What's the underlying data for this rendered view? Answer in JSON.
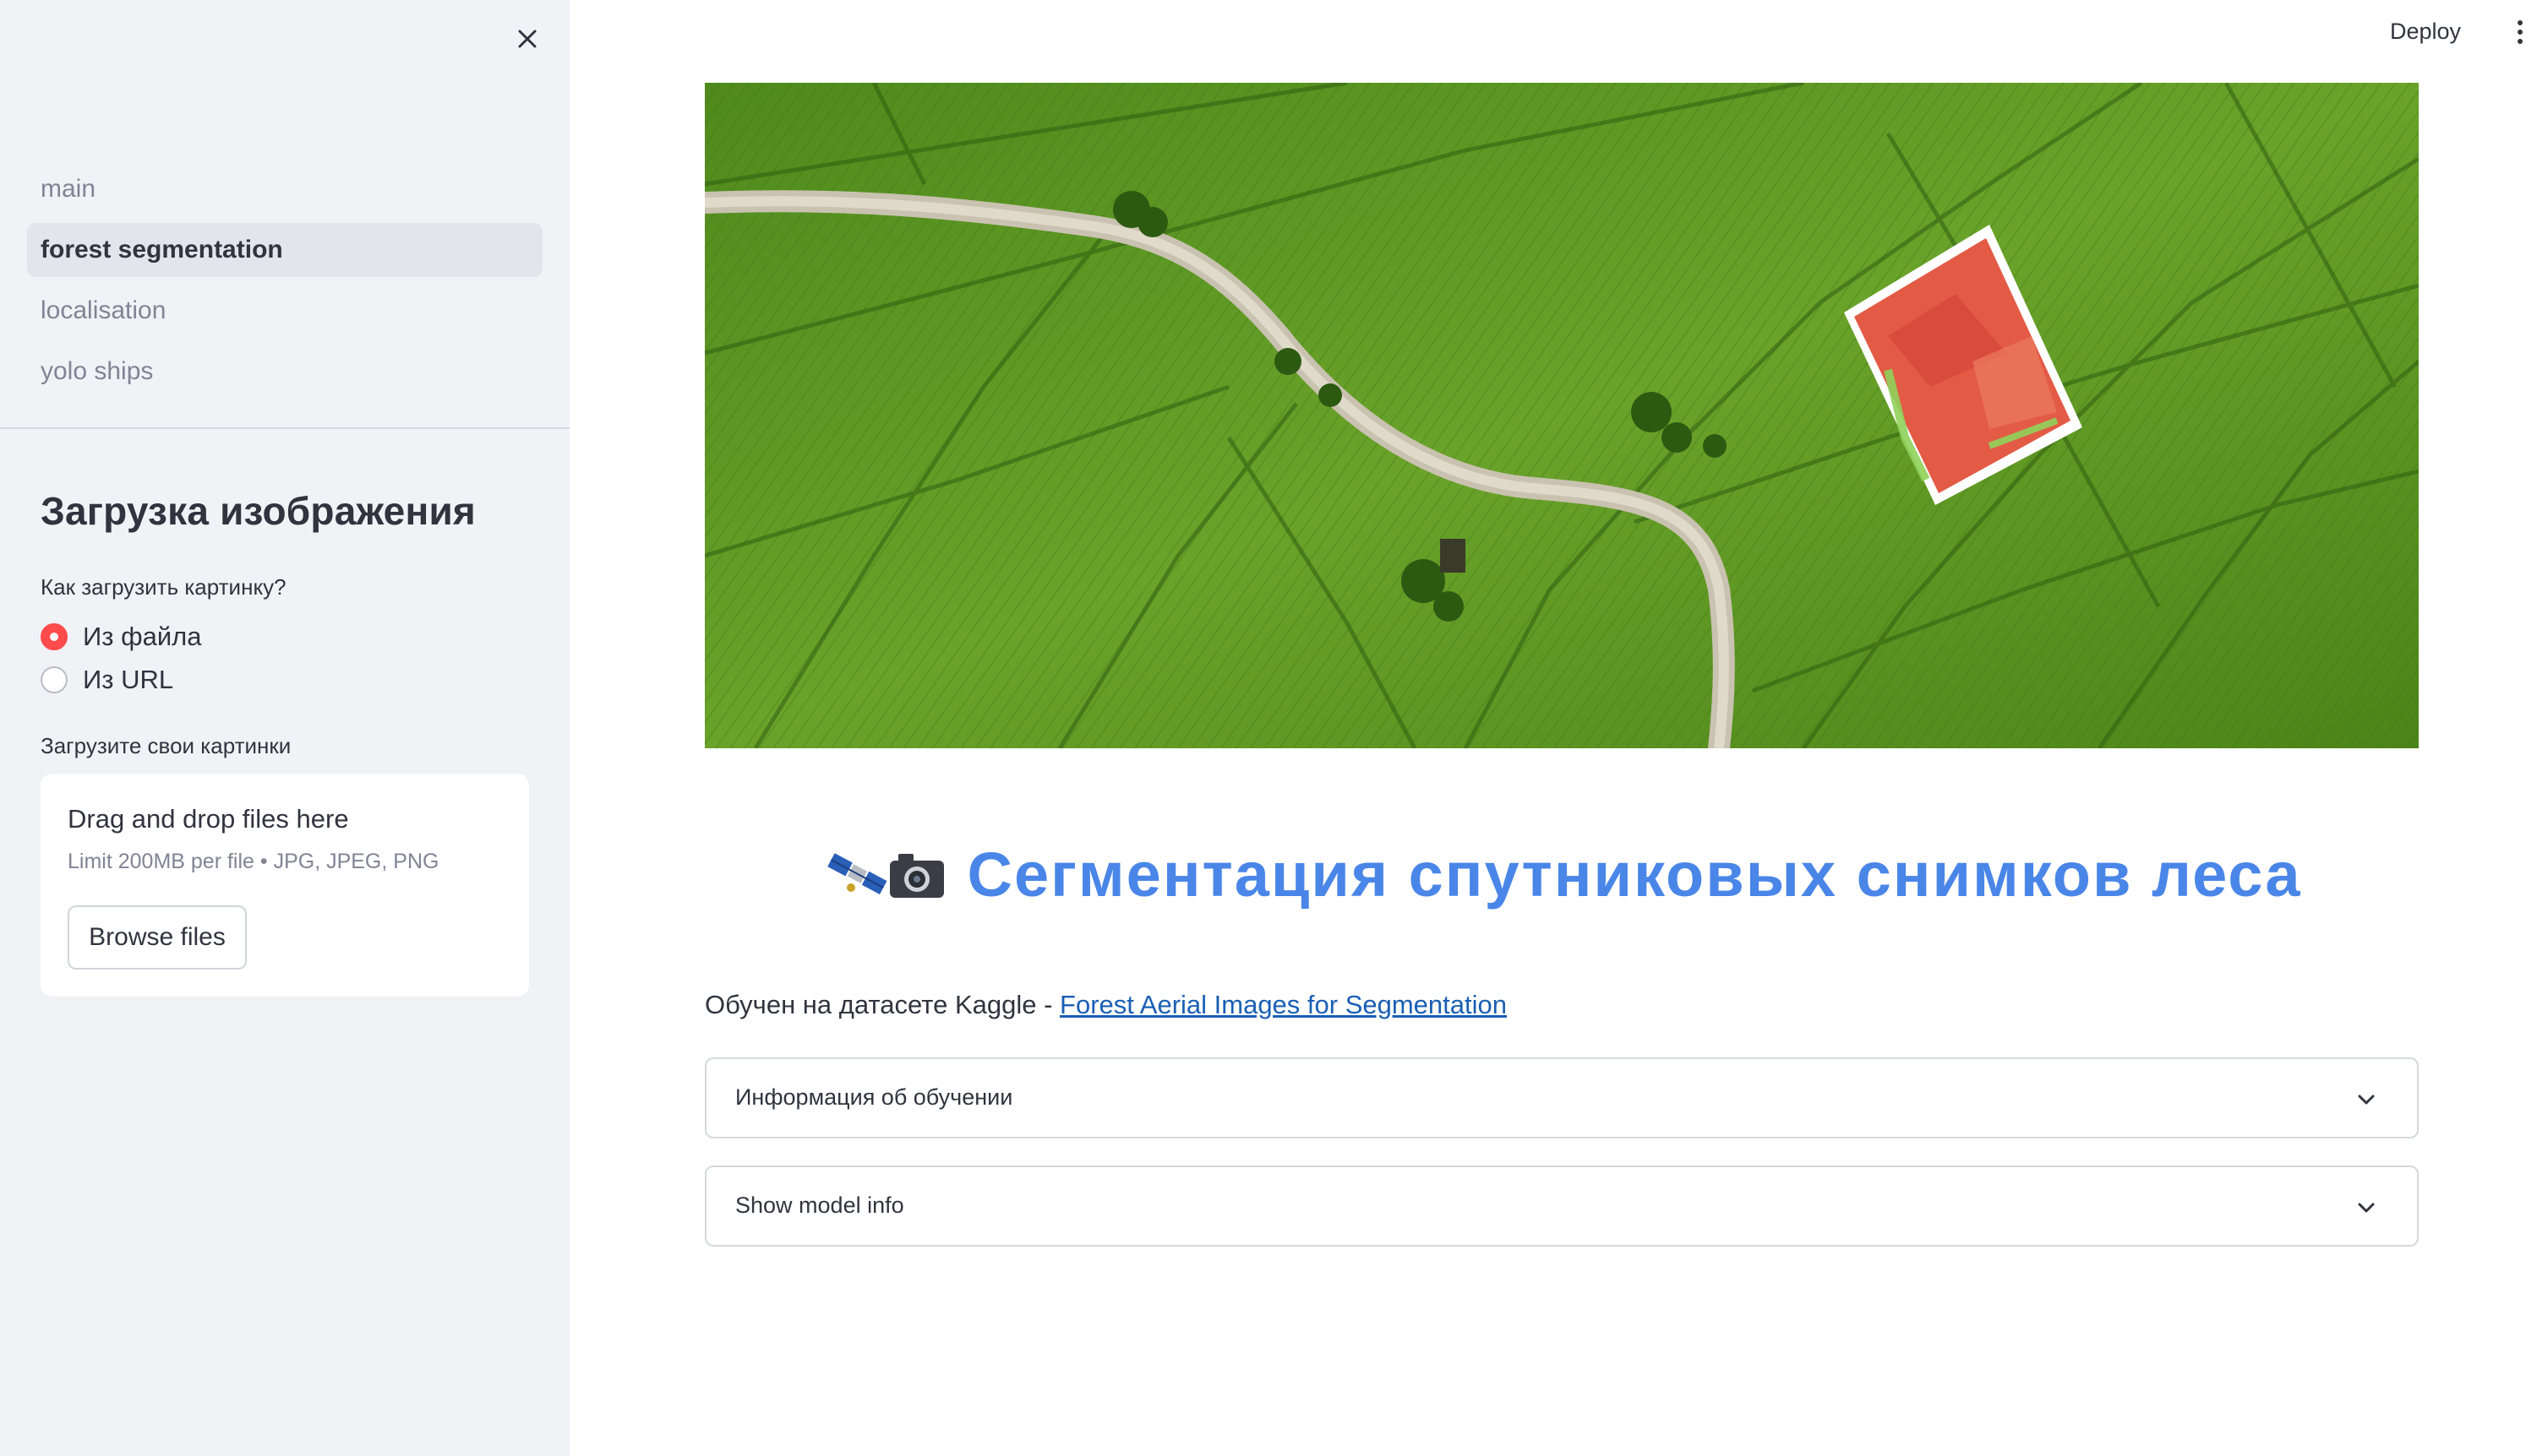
{
  "sidebar": {
    "nav": [
      {
        "label": "main",
        "active": false
      },
      {
        "label": "forest segmentation",
        "active": true
      },
      {
        "label": "localisation",
        "active": false
      },
      {
        "label": "yolo ships",
        "active": false
      }
    ],
    "heading": "Загрузка изображения",
    "upload_method_label": "Как загрузить картинку?",
    "upload_options": [
      {
        "label": "Из файла",
        "selected": true
      },
      {
        "label": "Из URL",
        "selected": false
      }
    ],
    "uploader_label": "Загрузите свои картинки",
    "dropzone": {
      "title": "Drag and drop files here",
      "limits": "Limit 200MB per file • JPG, JPEG, PNG",
      "browse_label": "Browse files"
    }
  },
  "header": {
    "deploy_label": "Deploy"
  },
  "main": {
    "title": "Сегментация спутниковых снимков леса",
    "title_emoji": "🛰️📷",
    "dataset_prefix": "Обучен на датасете Kaggle - ",
    "dataset_link": "Forest Aerial Images for Segmentation",
    "expanders": [
      {
        "label": "Информация об обучении"
      },
      {
        "label": "Show model info"
      }
    ]
  },
  "colors": {
    "accent": "#ff4b4b",
    "title_blue": "#4a86e8",
    "sidebar_bg": "#f0f2f6",
    "link": "#1a5fb4"
  }
}
